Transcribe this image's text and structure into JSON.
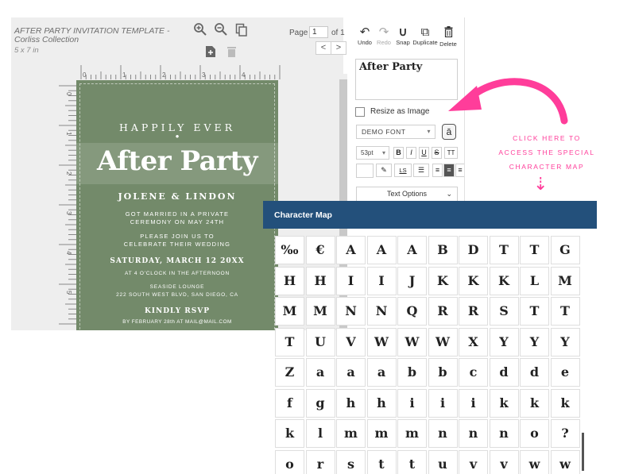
{
  "document": {
    "title": "AFTER PARTY INVITATION TEMPLATE -\nCorliss Collection",
    "size": "5 x 7 in"
  },
  "toolbar_left": {
    "zoom_in_icon": "zoom-in-icon",
    "zoom_out_icon": "zoom-out-icon",
    "pages_icon": "copy-pages-icon",
    "add_page_icon": "add-page-icon",
    "delete_page_icon": "trash-icon"
  },
  "pagination": {
    "label": "Page",
    "value": "1",
    "of": "of 1",
    "prev": "<",
    "next": ">"
  },
  "ruler": {
    "top": [
      "0",
      "1",
      "2",
      "3",
      "4"
    ],
    "left": [
      "0",
      "1",
      "2",
      "3",
      "4",
      "5",
      "6"
    ]
  },
  "card": {
    "line1": "HAPPILY EVER",
    "dot": "•",
    "headline": "After Party",
    "names": "JOLENE & LINDON",
    "p1": "GOT MARRIED IN A PRIVATE\nCEREMONY ON MAY 24TH",
    "p2": "PLEASE JOIN US TO\nCELEBRATE THEIR WEDDING",
    "date": "SATURDAY, MARCH 12 20XX",
    "time": "AT 4 O'CLOCK IN THE AFTERNOON",
    "venue": "SEASIDE LOUNGE\n222 SOUTH WEST BLVD, SAN DIEGO, CA",
    "rsvp": "KINDLY RSVP",
    "rsvp_by": "BY FEBRUARY 28th AT MAIL@MAIL.COM",
    "color": "#738a6a"
  },
  "panel": {
    "tools": [
      {
        "label": "Undo",
        "icon": "undo-icon",
        "glyph": "↶"
      },
      {
        "label": "Redo",
        "icon": "redo-icon",
        "glyph": "↷"
      },
      {
        "label": "Snap",
        "icon": "magnet-icon",
        "glyph": "∪"
      },
      {
        "label": "Duplicate",
        "icon": "duplicate-icon",
        "glyph": "⧉"
      },
      {
        "label": "Delete",
        "icon": "trash-icon",
        "glyph": "🗑"
      }
    ],
    "text_value": "After Party",
    "resize_label": "Resize as Image",
    "font": "DEMO FONT",
    "charmap_button": "ā",
    "size": "53pt",
    "format_buttons": [
      "B",
      "I",
      "U",
      "S",
      "TT"
    ],
    "text_options": "Text Options"
  },
  "annotation": {
    "text": "CLICK HERE TO\nACCESS THE SPECIAL\nCHARACTER MAP",
    "arrow_down": "⇣",
    "color": "#ff3d9a"
  },
  "character_map": {
    "title": "Character Map",
    "header_color": "#23507b",
    "rows": [
      [
        "‰",
        "€",
        "A",
        "A",
        "A",
        "B",
        "D",
        "T",
        "T",
        "G"
      ],
      [
        "H",
        "H",
        "I",
        "I",
        "J",
        "K",
        "K",
        "K",
        "L",
        "M"
      ],
      [
        "M",
        "M",
        "N",
        "N",
        "Q",
        "R",
        "R",
        "S",
        "T",
        "T"
      ],
      [
        "T",
        "U",
        "V",
        "W",
        "W",
        "W",
        "X",
        "Y",
        "Y",
        "Y"
      ],
      [
        "Z",
        "a",
        "a",
        "a",
        "b",
        "b",
        "c",
        "d",
        "d",
        "e"
      ],
      [
        "f",
        "g",
        "h",
        "h",
        "i",
        "i",
        "i",
        "k",
        "k",
        "k"
      ],
      [
        "k",
        "l",
        "m",
        "m",
        "m",
        "n",
        "n",
        "n",
        "o",
        "?"
      ],
      [
        "o",
        "r",
        "s",
        "t",
        "t",
        "u",
        "v",
        "v",
        "w",
        "w"
      ]
    ]
  }
}
